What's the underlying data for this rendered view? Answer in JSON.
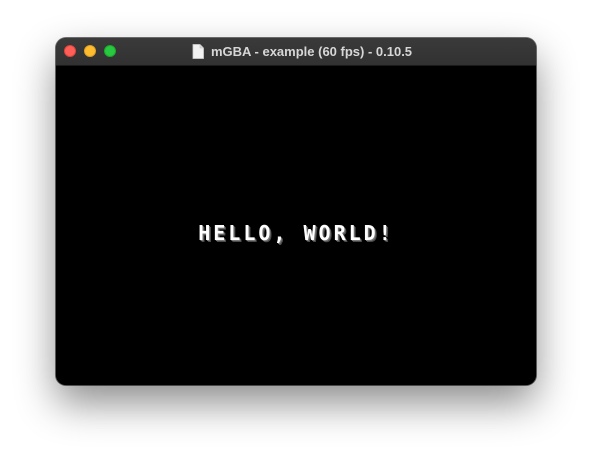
{
  "window": {
    "title": "mGBA - example (60 fps) - 0.10.5"
  },
  "controls": {
    "close_icon": "red-circle",
    "minimize_icon": "yellow-circle",
    "zoom_icon": "green-circle"
  },
  "screen": {
    "text": "HELLO, WORLD!"
  },
  "colors": {
    "titlebar": "#353435",
    "screen_bg": "#000000",
    "text": "#ffffff",
    "close": "#ff5f57",
    "minimize": "#febc2e",
    "zoom": "#28c840"
  }
}
